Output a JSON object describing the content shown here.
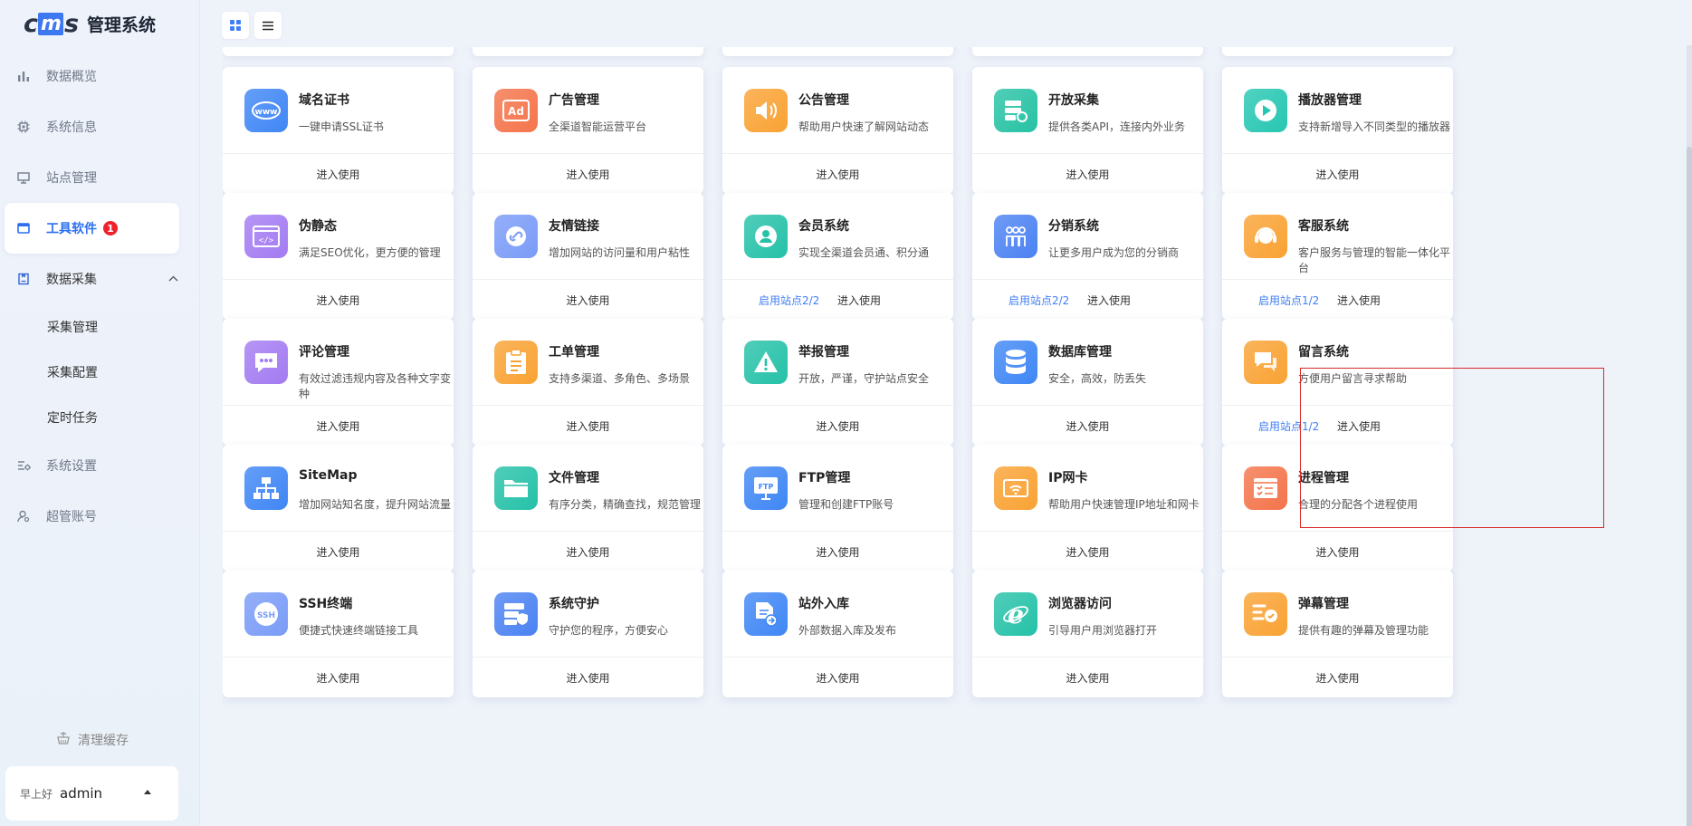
{
  "brand": {
    "logo_prefix": "c",
    "logo_mid": "m",
    "logo_suffix": "s",
    "title": "管理系统"
  },
  "menu": {
    "items": [
      {
        "label": "数据概览",
        "icon": "bar-chart-icon"
      },
      {
        "label": "系统信息",
        "icon": "chip-icon"
      },
      {
        "label": "站点管理",
        "icon": "monitor-icon"
      },
      {
        "label": "工具软件",
        "icon": "window-icon",
        "badge": "1"
      },
      {
        "label": "数据采集",
        "icon": "clipboard-icon"
      }
    ],
    "sub_items": [
      {
        "label": "采集管理"
      },
      {
        "label": "采集配置"
      },
      {
        "label": "定时任务"
      }
    ],
    "items_after": [
      {
        "label": "系统设置",
        "icon": "settings-list-icon"
      },
      {
        "label": "超管账号",
        "icon": "user-gear-icon"
      }
    ]
  },
  "sidebar_footer": {
    "clear_cache": "清理缓存",
    "greeting": "早上好",
    "username": "admin"
  },
  "enter_label": "进入使用",
  "cards": [
    {
      "title": "域名证书",
      "desc": "一键申请SSL证书",
      "icon": "www-icon",
      "color": "#3f86f5"
    },
    {
      "title": "广告管理",
      "desc": "全渠道智能运营平台",
      "icon": "ad-icon",
      "color": "#f4744b"
    },
    {
      "title": "公告管理",
      "desc": "帮助用户快速了解网站动态",
      "icon": "speaker-icon",
      "color": "#f9a233"
    },
    {
      "title": "开放采集",
      "desc": "提供各类API，连接内外业务",
      "icon": "server-icon",
      "color": "#26c2a4"
    },
    {
      "title": "播放器管理",
      "desc": "支持新增导入不同类型的播放器",
      "icon": "play-icon",
      "color": "#26c6b2"
    },
    {
      "title": "伪静态",
      "desc": "满足SEO优化，更方便的管理",
      "icon": "code-window-icon",
      "color": "#a37bf2"
    },
    {
      "title": "友情链接",
      "desc": "增加网站的访问量和用户粘性",
      "icon": "link-icon",
      "color": "#7a9bf7"
    },
    {
      "title": "会员系统",
      "desc": "实现全渠道会员通、积分通",
      "icon": "member-icon",
      "color": "#25c1a8",
      "enable": "启用站点2/2"
    },
    {
      "title": "分销系统",
      "desc": "让更多用户成为您的分销商",
      "icon": "people-icon",
      "color": "#4b82f2",
      "enable": "启用站点2/2"
    },
    {
      "title": "客服系统",
      "desc": "客户服务与管理的智能一体化平台",
      "icon": "headset-icon",
      "color": "#f9a233",
      "enable": "启用站点1/2"
    },
    {
      "title": "评论管理",
      "desc": "有效过滤违规内容及各种文字变种",
      "icon": "comment-icon",
      "color": "#a37bf2"
    },
    {
      "title": "工单管理",
      "desc": "支持多渠道、多角色、多场景",
      "icon": "clipboard-list-icon",
      "color": "#f9a233"
    },
    {
      "title": "举报管理",
      "desc": "开放，严谨，守护站点安全",
      "icon": "warning-icon",
      "color": "#25c1a8"
    },
    {
      "title": "数据库管理",
      "desc": "安全，高效，防丢失",
      "icon": "database-icon",
      "color": "#3f86f5"
    },
    {
      "title": "留言系统",
      "desc": "方便用户留言寻求帮助",
      "icon": "chat-icon",
      "color": "#f9a233",
      "enable": "启用站点1/2"
    },
    {
      "title": "SiteMap",
      "desc": "增加网站知名度，提升网站流量",
      "icon": "sitemap-icon",
      "color": "#3f86f5"
    },
    {
      "title": "文件管理",
      "desc": "有序分类，精确查找，规范管理",
      "icon": "folder-icon",
      "color": "#25c1a8"
    },
    {
      "title": "FTP管理",
      "desc": "管理和创建FTP账号",
      "icon": "ftp-icon",
      "color": "#3f86f5"
    },
    {
      "title": "IP网卡",
      "desc": "帮助用户快速管理IP地址和网卡",
      "icon": "wifi-card-icon",
      "color": "#f9a233"
    },
    {
      "title": "进程管理",
      "desc": "合理的分配各个进程使用",
      "icon": "process-icon",
      "color": "#f4744b"
    },
    {
      "title": "SSH终端",
      "desc": "便捷式快速终端链接工具",
      "icon": "ssh-icon",
      "color": "#7a9bf7"
    },
    {
      "title": "系统守护",
      "desc": "守护您的程序，方便安心",
      "icon": "shield-server-icon",
      "color": "#4b82f2"
    },
    {
      "title": "站外入库",
      "desc": "外部数据入库及发布",
      "icon": "import-doc-icon",
      "color": "#3f86f5"
    },
    {
      "title": "浏览器访问",
      "desc": "引导用户用浏览器打开",
      "icon": "browser-icon",
      "color": "#25c1a8"
    },
    {
      "title": "弹幕管理",
      "desc": "提供有趣的弹幕及管理功能",
      "icon": "barrage-icon",
      "color": "#f9a233"
    }
  ]
}
